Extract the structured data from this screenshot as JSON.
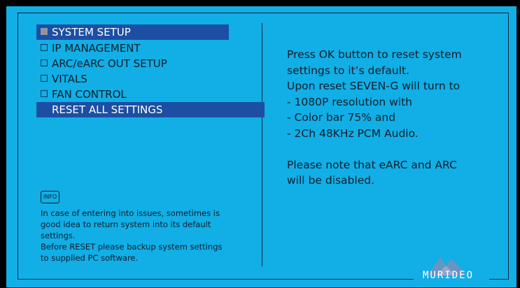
{
  "menu": {
    "title": "SYSTEM SETUP",
    "items": [
      {
        "label": "IP MANAGEMENT"
      },
      {
        "label": "ARC/eARC OUT SETUP"
      },
      {
        "label": "VITALS"
      },
      {
        "label": "FAN CONTROL"
      },
      {
        "label": "RESET ALL SETTINGS",
        "selected": true
      }
    ]
  },
  "info": {
    "icon_label": "INFO",
    "text": "In case of entering into issues, sometimes is\ngood idea to return system into its default\nsettings.\nBefore RESET please backup system settings\nto supplied PC software."
  },
  "message": "Press OK button to reset system\nsettings to it’s default.\nUpon reset SEVEN-G will turn to\n- 1080P resolution with\n-  Color bar 75% and\n- 2Ch 48KHz PCM Audio.\n\nPlease note that eARC and ARC\nwill be disabled.",
  "brand": {
    "name": "MURIDEO",
    "icon": "mountain-logo-icon"
  },
  "colors": {
    "background": "#12aee6",
    "highlight": "#1c4fa3",
    "text": "#0c1e2b"
  }
}
